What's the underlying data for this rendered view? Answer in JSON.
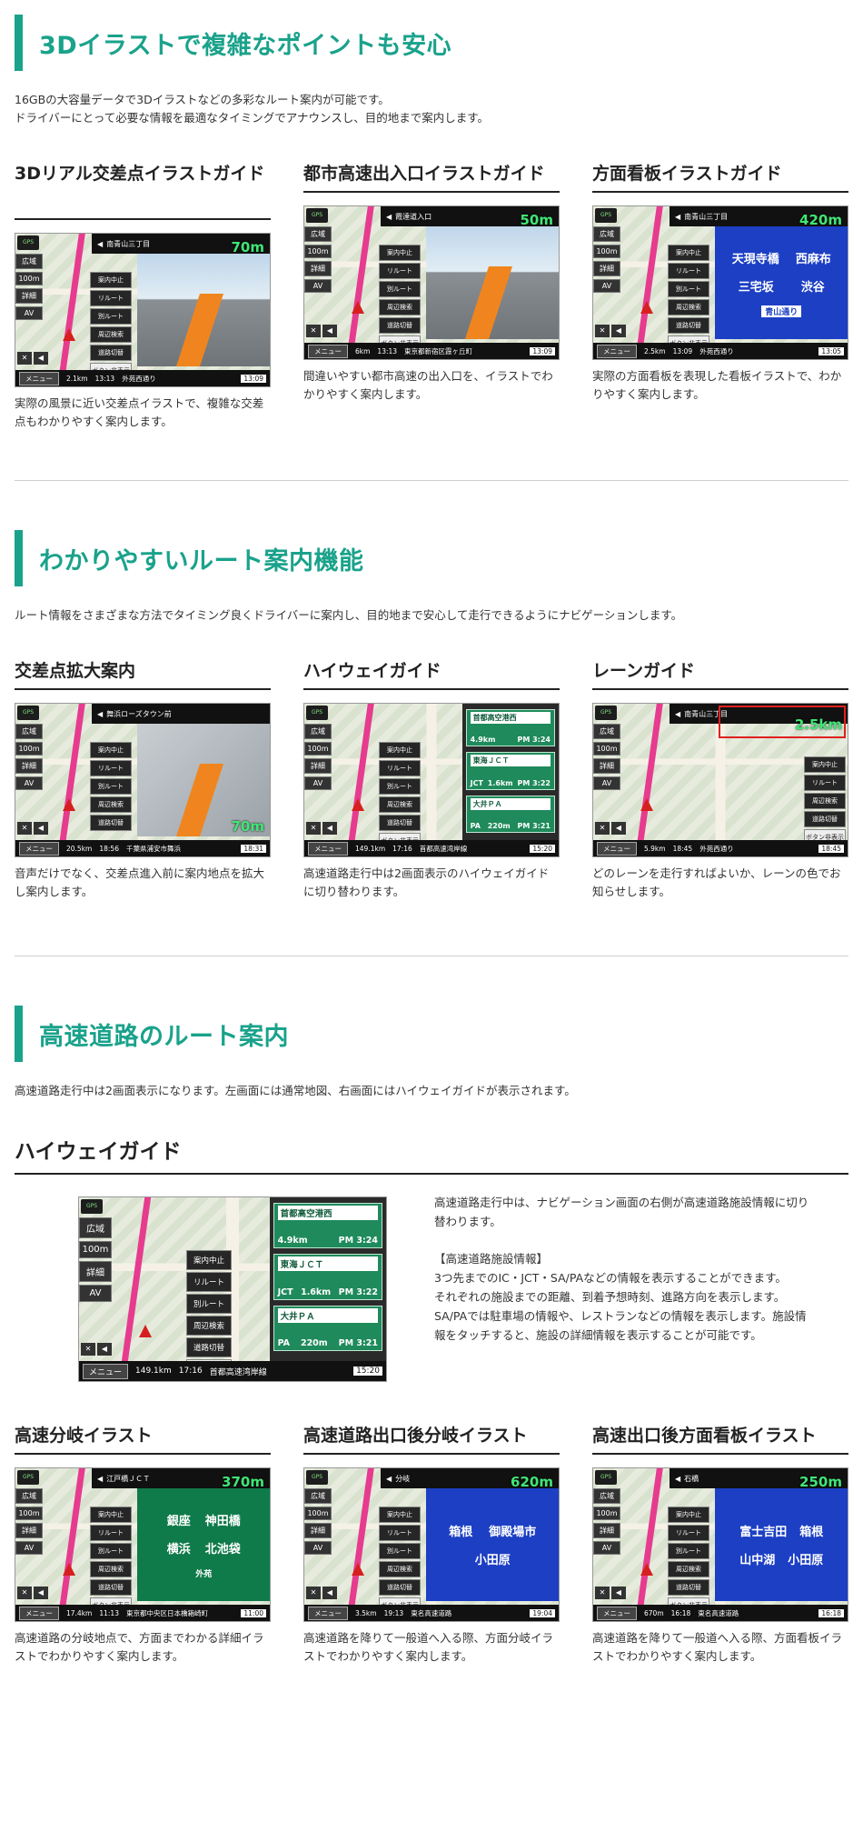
{
  "sections": [
    {
      "title": "3Dイラストで複雑なポイントも安心",
      "desc": [
        "16GBの大容量データで3Dイラストなどの多彩なルート案内が可能です。",
        "ドライバーにとって必要な情報を最適なタイミングでアナウンスし、目的地まで案内します。"
      ],
      "items": [
        {
          "title": "3Dリアル交差点イラストガイド",
          "text": "実際の風景に近い交差点イラストで、複雑な交差点もわかりやすく案内します。",
          "screen": {
            "road": "南青山三丁目",
            "dist": "70m",
            "left_dist": "2.1km",
            "time": "13:13",
            "place": "外苑西通り",
            "clock": "13:09"
          }
        },
        {
          "title": "都市高速出入口イラストガイド",
          "text": "間違いやすい都市高速の出入口を、イラストでわかりやすく案内します。",
          "screen": {
            "road": "霞達道入口",
            "dist": "50m",
            "left_dist": "6km",
            "time": "13:13",
            "place": "東京都新宿区霞ヶ丘町",
            "clock": "13:09"
          }
        },
        {
          "title": "方面看板イラストガイド",
          "text": "実際の方面看板を表現した看板イラストで、わかりやすく案内します。",
          "screen": {
            "road": "南青山三丁目",
            "dist": "420m",
            "left_dist": "2.5km",
            "time": "13:09",
            "place": "外苑西通り",
            "clock": "13:05",
            "sign": {
              "top_left": "天現寺橋",
              "top_right": "西麻布",
              "mid_left": "三宅坂",
              "mid_right": "渋谷",
              "bottom": "青山通り"
            }
          }
        }
      ]
    },
    {
      "title": "わかりやすいルート案内機能",
      "desc": [
        "ルート情報をさまざまな方法でタイミング良くドライバーに案内し、目的地まで安心して走行できるようにナビゲーションします。"
      ],
      "items": [
        {
          "title": "交差点拡大案内",
          "text": "音声だけでなく、交差点進入前に案内地点を拡大し案内します。",
          "screen": {
            "road": "舞浜ローズタウン前",
            "dist": "70m",
            "left_dist": "20.5km",
            "time": "18:56",
            "place": "千葉県浦安市舞浜",
            "clock": "18:31"
          }
        },
        {
          "title": "ハイウェイガイド",
          "text": "高速道路走行中は2画面表示のハイウェイガイドに切り替わります。",
          "screen": {
            "left_dist": "149.1km",
            "time": "17:16",
            "place": "首都高速湾岸線",
            "clock": "15:20"
          }
        },
        {
          "title": "レーンガイド",
          "text": "どのレーンを走行すればよいか、レーンの色でお知らせします。",
          "screen": {
            "road": "南青山三丁目",
            "dist": "2.5km",
            "left_dist": "5.9km",
            "time": "18:45",
            "place": "外苑西通り",
            "clock": "18:45"
          }
        }
      ]
    },
    {
      "title": "高速道路のルート案内",
      "desc": [
        "高速道路走行中は2画面表示になります。左画面には通常地図、右画面にはハイウェイガイドが表示されます。"
      ],
      "feature_title": "ハイウェイガイド",
      "feature_text": [
        "高速道路走行中は、ナビゲーション画面の右側が高速道路施設情報に切り替わります。",
        "",
        "【高速道路施設情報】",
        "3つ先までのIC・JCT・SA/PAなどの情報を表示することができます。",
        "それぞれの施設までの距離、到着予想時刻、進路方向を表示します。",
        "SA/PAでは駐車場の情報や、レストランなどの情報を表示します。施設情報をタッチすると、施設の詳細情報を表示することが可能です。"
      ],
      "items": [
        {
          "title": "高速分岐イラスト",
          "text": "高速道路の分岐地点で、方面までわかる詳細イラストでわかりやすく案内します。",
          "screen": {
            "road": "江戸橋ＪＣＴ",
            "dist": "370m",
            "left_dist": "17.4km",
            "time": "11:13",
            "place": "東京都中央区日本橋箱崎町",
            "clock": "11:00",
            "sign": {
              "top_left": "銀座",
              "top_right": "神田橋",
              "mid_left": "横浜",
              "mid_right": "北池袋",
              "bottom": "外苑"
            }
          }
        },
        {
          "title": "高速道路出口後分岐イラスト",
          "text": "高速道路を降りて一般道へ入る際、方面分岐イラストでわかりやすく案内します。",
          "screen": {
            "road": "分岐",
            "dist": "620m",
            "left_dist": "3.5km",
            "time": "19:13",
            "place": "東名高速道路",
            "clock": "19:04",
            "sign": {
              "top_left": "箱根",
              "top_right": "御殿場市",
              "mid_left": "小田原",
              "mid_right": "",
              "bottom": ""
            }
          }
        },
        {
          "title": "高速出口後方面看板イラスト",
          "text": "高速道路を降りて一般道へ入る際、方面看板イラストでわかりやすく案内します。",
          "screen": {
            "road": "石橋",
            "dist": "250m",
            "left_dist": "670m",
            "time": "16:18",
            "place": "東名高速道路",
            "clock": "16:18",
            "sign": {
              "top_left": "富士吉田",
              "top_right": "箱根",
              "mid_left": "山中湖",
              "mid_right": "小田原",
              "bottom": ""
            }
          }
        }
      ]
    }
  ],
  "nav_ui": {
    "gps": "GPS",
    "left_buttons": [
      "広域",
      "100m",
      "詳細",
      "AV"
    ],
    "menu_buttons": [
      "案内中止",
      "リルート",
      "別ルート",
      "周辺検索",
      "道路切替",
      "ボタン非表示"
    ],
    "menu_label": "メニュー",
    "sound_icons": [
      "✕",
      "◀"
    ]
  },
  "highway": {
    "items": [
      {
        "name": "首都高空港西",
        "dist": "4.9km",
        "time": "PM 3:24",
        "type": ""
      },
      {
        "name": "東海ＪＣＴ",
        "dist": "1.6km",
        "time": "PM 3:22",
        "type": "JCT"
      },
      {
        "name": "大井ＰＡ",
        "dist": "220m",
        "time": "PM 3:21",
        "type": "PA"
      }
    ]
  }
}
